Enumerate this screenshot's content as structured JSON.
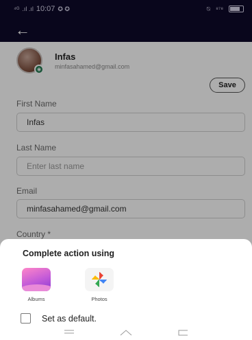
{
  "status": {
    "left_text": "⁴ᴳ ..ıl ...ıl 10:07",
    "right_text": "ℹℹ"
  },
  "profile": {
    "name": "Infas",
    "email": "minfasahamed@gmail.com"
  },
  "actions": {
    "save_label": "Save"
  },
  "form": {
    "first_name": {
      "label": "First Name",
      "value": "Infas"
    },
    "last_name": {
      "label": "Last Name",
      "placeholder": "Enter last name"
    },
    "email": {
      "label": "Email",
      "value": "minfasahamed@gmail.com"
    },
    "country": {
      "label": "Country *"
    }
  },
  "sheet": {
    "title": "Complete action using",
    "apps": [
      {
        "label": "Albums",
        "icon": "albums-icon"
      },
      {
        "label": "Photos",
        "icon": "google-photos-icon"
      }
    ],
    "default_label": "Set as default."
  },
  "nav": {
    "icons": [
      "menu-icon",
      "home-icon",
      "back-icon"
    ]
  },
  "colors": {
    "app_bar": "#0e0a2a",
    "dim_overlay": "rgba(0,0,0,0.32)"
  }
}
